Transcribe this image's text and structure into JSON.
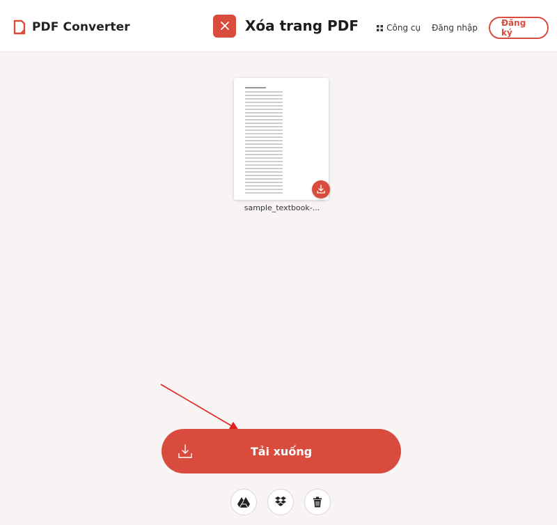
{
  "header": {
    "logo_text": "PDF Converter",
    "tool_title": "Xóa trang PDF",
    "nav": {
      "tools_label": "Công cụ",
      "login_label": "Đăng nhập",
      "signup_label": "Đăng ký"
    }
  },
  "file": {
    "name": "sample_textbook-..."
  },
  "download": {
    "label": "Tải xuống"
  },
  "actions": [
    {
      "name": "google-drive-icon"
    },
    {
      "name": "dropbox-icon"
    },
    {
      "name": "trash-icon"
    }
  ],
  "colors": {
    "accent": "#d94c3d",
    "background": "#f8f4f3",
    "header_bg": "#ffffff"
  }
}
